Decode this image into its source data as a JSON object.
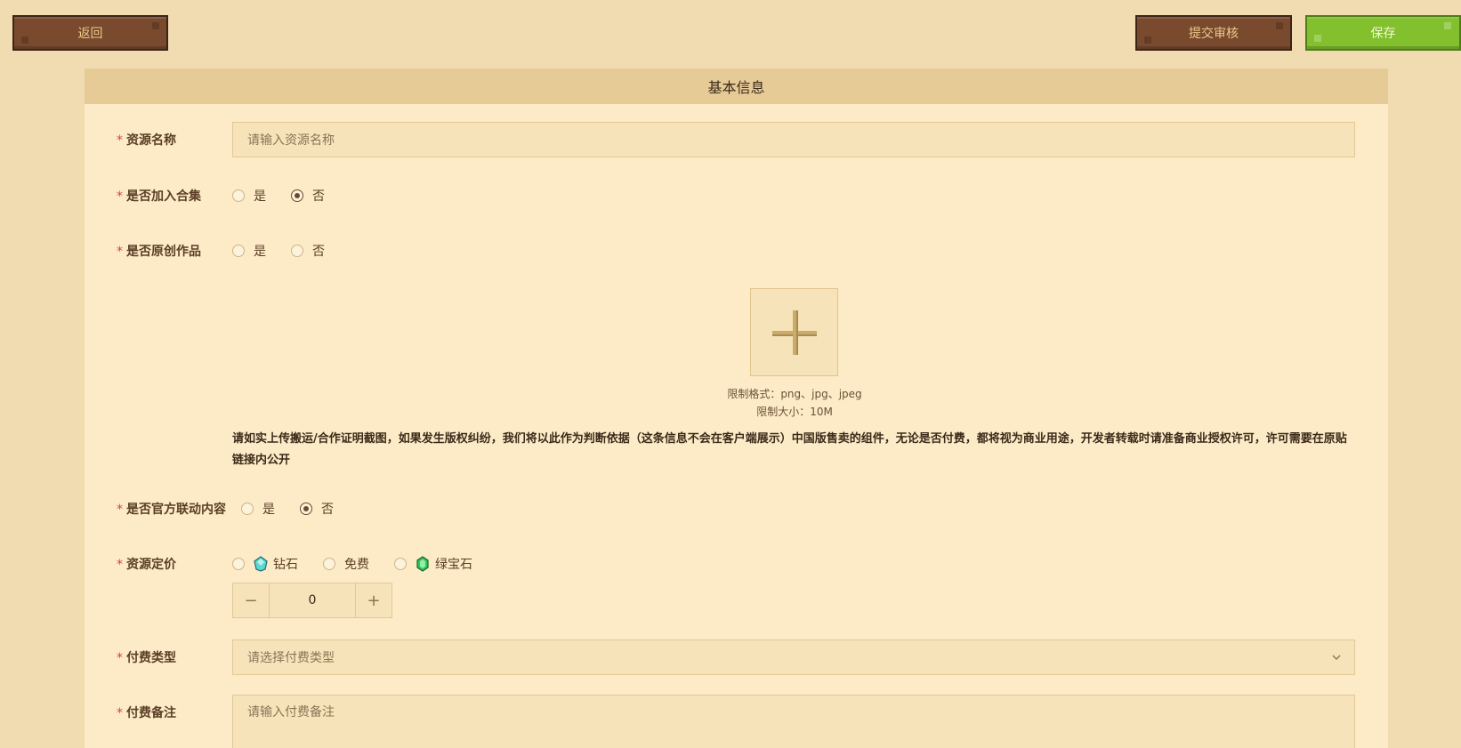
{
  "toolbar": {
    "back_label": "返回",
    "submit_label": "提交审核",
    "save_label": "保存"
  },
  "section": {
    "title": "基本信息"
  },
  "form": {
    "required_mark": "*",
    "name": {
      "label": "资源名称",
      "placeholder": "请输入资源名称"
    },
    "collection": {
      "label": "是否加入合集",
      "options": [
        "是",
        "否"
      ],
      "selected": "否"
    },
    "original": {
      "label": "是否原创作品",
      "options": [
        "是",
        "否"
      ],
      "selected": ""
    },
    "upload": {
      "format_hint": "限制格式：png、jpg、jpeg",
      "size_hint": "限制大小：10M"
    },
    "notice": "请如实上传搬运/合作证明截图，如果发生版权纠纷，我们将以此作为判断依据（这条信息不会在客户端展示）中国版售卖的组件，无论是否付费，都将视为商业用途，开发者转载时请准备商业授权许可，许可需要在原贴链接内公开",
    "official": {
      "label": "是否官方联动内容",
      "options": [
        "是",
        "否"
      ],
      "selected": "否"
    },
    "pricing": {
      "label": "资源定价",
      "options": [
        {
          "label": "钻石",
          "icon": "diamond-icon"
        },
        {
          "label": "免费",
          "icon": ""
        },
        {
          "label": "绿宝石",
          "icon": "emerald-icon"
        }
      ],
      "value": "0",
      "minus": "−",
      "plus": "+"
    },
    "pay_type": {
      "label": "付费类型",
      "placeholder": "请选择付费类型"
    },
    "pay_note": {
      "label": "付费备注",
      "placeholder": "请输入付费备注"
    }
  },
  "colors": {
    "brand_brown": "#7a4a2e",
    "brand_green": "#82c02d",
    "panel": "#fdeac6",
    "required": "#d6423a"
  }
}
